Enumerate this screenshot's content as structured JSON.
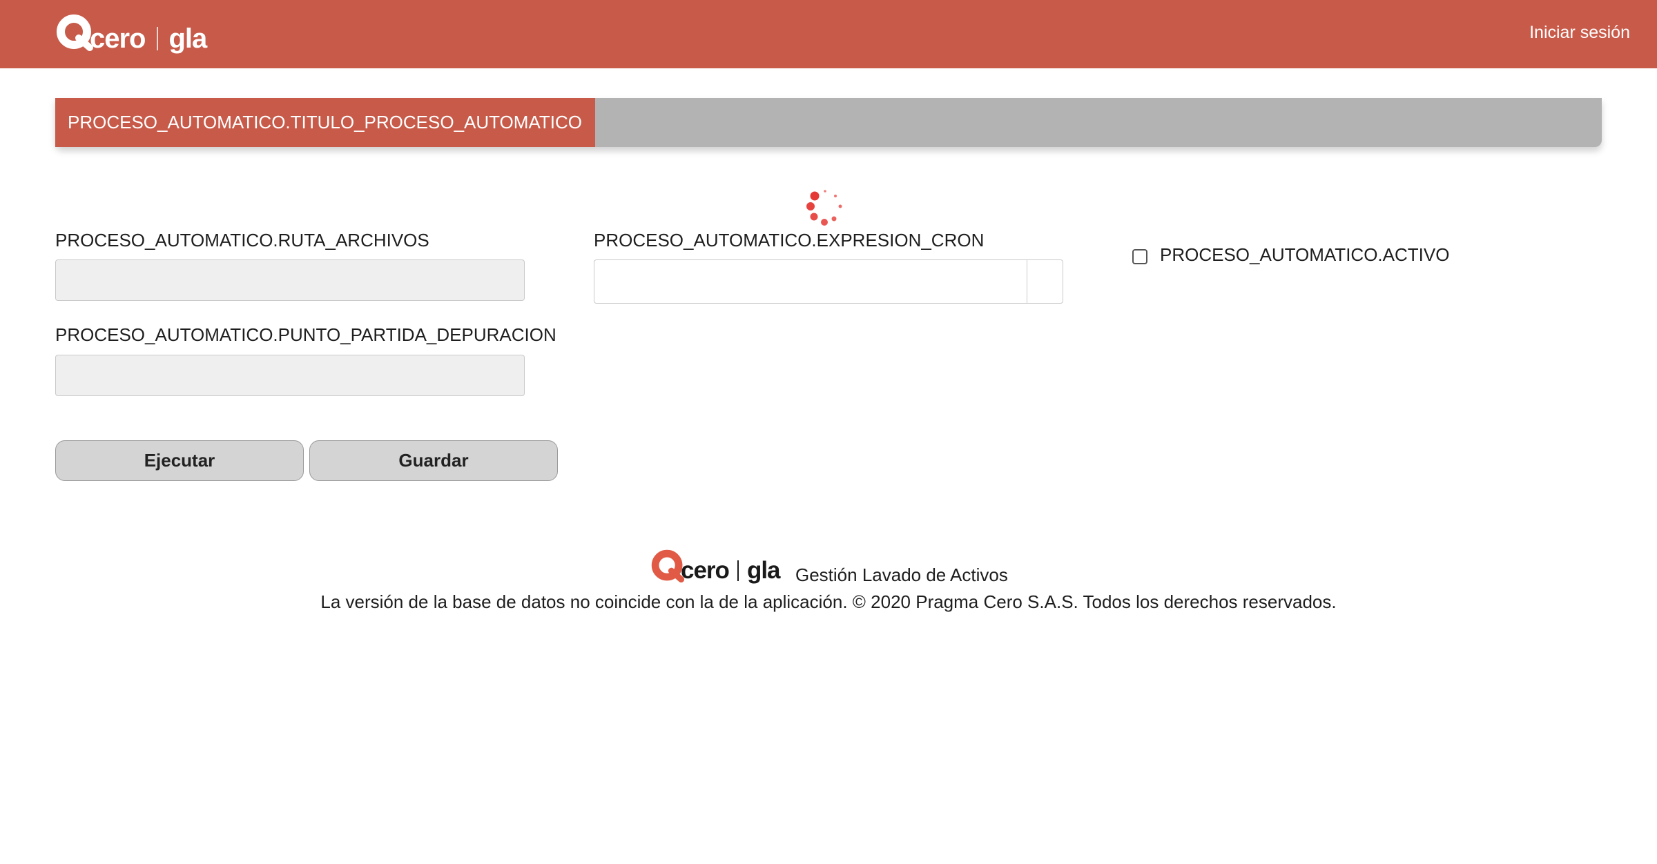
{
  "header": {
    "brand": {
      "name": "cero",
      "product": "gla"
    },
    "login_label": "Iniciar sesión"
  },
  "page": {
    "title": "PROCESO_AUTOMATICO.TITULO_PROCESO_AUTOMATICO",
    "loading": true
  },
  "form": {
    "ruta_archivos": {
      "label": "PROCESO_AUTOMATICO.RUTA_ARCHIVOS",
      "value": "",
      "disabled": true
    },
    "punto_partida": {
      "label": "PROCESO_AUTOMATICO.PUNTO_PARTIDA_DEPURACION",
      "value": "",
      "disabled": true
    },
    "expresion_cron": {
      "label": "PROCESO_AUTOMATICO.EXPRESION_CRON",
      "value": ""
    },
    "activo": {
      "label": "PROCESO_AUTOMATICO.ACTIVO",
      "checked": false
    },
    "buttons": {
      "execute": "Ejecutar",
      "save": "Guardar"
    }
  },
  "footer": {
    "brand": {
      "name": "cero",
      "product": "gla"
    },
    "app_name": "Gestión Lavado de Activos",
    "copyright": "La versión de la base de datos no coincide con la de la aplicación. © 2020 Pragma Cero S.A.S. Todos los derechos reservados."
  },
  "colors": {
    "brand_red": "#c85a49",
    "title_bar_gray": "#b3b3b3",
    "spinner_red": "#e53935",
    "button_gray": "#d4d4d4"
  }
}
